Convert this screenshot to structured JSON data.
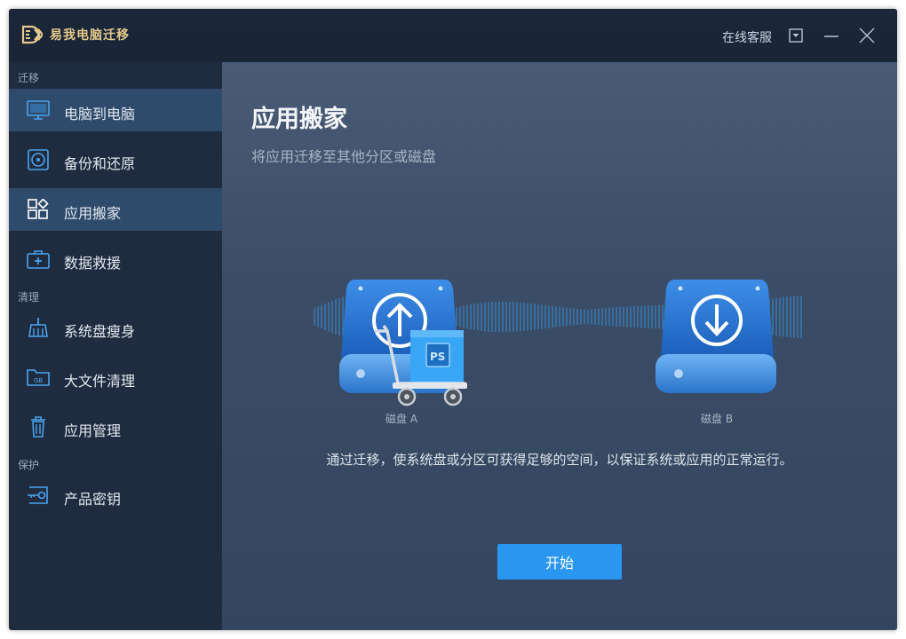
{
  "titlebar": {
    "app_name": "易我电脑迁移",
    "support_label": "在线客服",
    "logo_icon": "ed-logo-icon",
    "buttons": [
      "dropdown-icon",
      "minimize-icon",
      "close-icon"
    ]
  },
  "sidebar": {
    "sections": [
      {
        "label": "迁移",
        "items": [
          {
            "label": "电脑到电脑",
            "icon": "monitor-icon",
            "active": true
          },
          {
            "label": "备份和还原",
            "icon": "backup-disc-icon",
            "active": false
          },
          {
            "label": "应用搬家",
            "icon": "apps-grid-icon",
            "active": true
          },
          {
            "label": "数据救援",
            "icon": "rescue-kit-icon",
            "active": false
          }
        ]
      },
      {
        "label": "清理",
        "items": [
          {
            "label": "系统盘瘦身",
            "icon": "broom-icon",
            "active": false
          },
          {
            "label": "大文件清理",
            "icon": "folder-gb-icon",
            "active": false
          },
          {
            "label": "应用管理",
            "icon": "trash-icon",
            "active": false
          }
        ]
      },
      {
        "label": "保护",
        "items": [
          {
            "label": "产品密钥",
            "icon": "key-icon",
            "active": false
          }
        ]
      }
    ]
  },
  "main": {
    "title": "应用搬家",
    "subtitle": "将应用迁移至其他分区或磁盘",
    "disk_a_label": "磁盘 A",
    "disk_b_label": "磁盘 B",
    "box_label": "PS",
    "description": "通过迁移，使系统盘或分区可获得足够的空间，以保证系统或应用的正常运行。",
    "start_button": "开始"
  },
  "colors": {
    "accent": "#2997f0",
    "title_gold": "#e4c98b",
    "sidebar_bg": "#1f2c3f",
    "active_item_bg": "#2f4b6c"
  }
}
